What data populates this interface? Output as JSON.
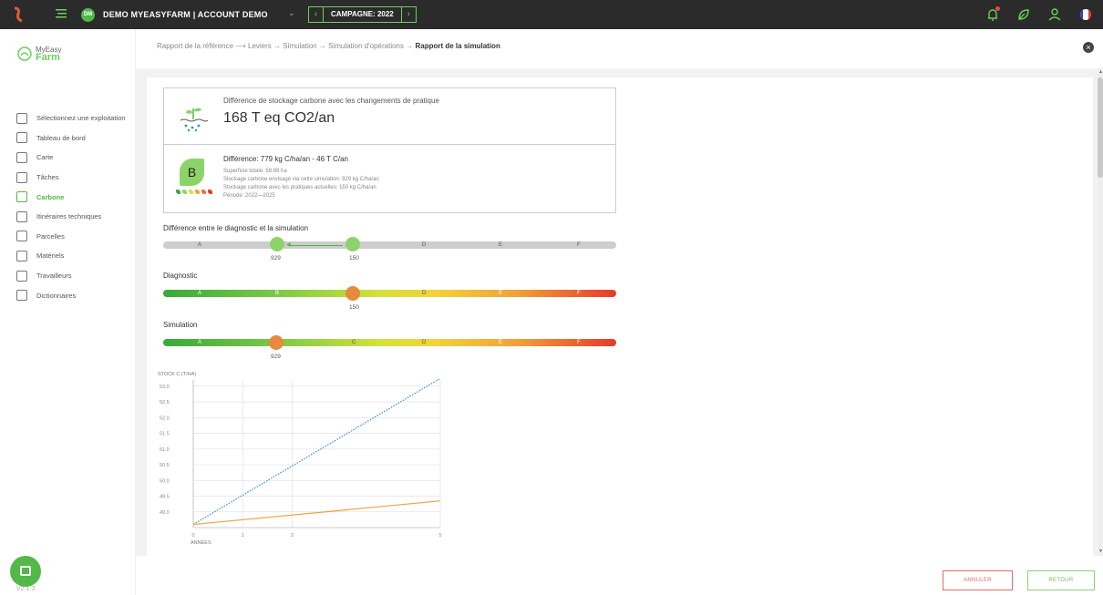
{
  "topbar": {
    "account": "DEMO MYEASYFARM | ACCOUNT DEMO",
    "avatar_initials": "DM",
    "campaign": "CAMPAGNE: 2022",
    "prev_arrow": "‹",
    "next_arrow": "›"
  },
  "brand": {
    "line1": "MyEasy",
    "line2": "Farm"
  },
  "sidebar": {
    "items": [
      {
        "label": "Sélectionnez une exploitation",
        "icon": "farm-select-icon"
      },
      {
        "label": "Tableau de bord",
        "icon": "dashboard-icon"
      },
      {
        "label": "Carte",
        "icon": "map-icon"
      },
      {
        "label": "Tâches",
        "icon": "tasks-icon"
      },
      {
        "label": "Carbone",
        "icon": "carbon-icon",
        "active": true
      },
      {
        "label": "Itinéraires techniques",
        "icon": "itinerary-icon"
      },
      {
        "label": "Parcelles",
        "icon": "parcels-icon"
      },
      {
        "label": "Matériels",
        "icon": "equipment-icon"
      },
      {
        "label": "Travailleurs",
        "icon": "workers-icon"
      },
      {
        "label": "Dictionnaires",
        "icon": "dictionary-icon"
      }
    ],
    "version": "V2.1.3"
  },
  "breadcrumb": {
    "items": [
      "Rapport de la référence",
      "Leviers",
      "Simulation",
      "Simulation d'opérations"
    ],
    "separators": [
      "⟶",
      "→",
      "→",
      "→"
    ],
    "current": "Rapport de la simulation"
  },
  "card1": {
    "title": "Différence de stockage carbone avec les changements de pratique",
    "value": "168 T eq CO2/an"
  },
  "card2": {
    "grade": "B",
    "title": "Différence: 779 kg C/ha/an - 46 T C/an",
    "lines": [
      "Superficie totale: 58.89 ha",
      "Stockage carbone envisagé via cette simulation: 929 kg C/ha/an",
      "Stockage carbone avec les pratiques actuelles: 150 kg C/ha/an",
      "Période: 2022—2025"
    ]
  },
  "grades": [
    "A",
    "B",
    "C",
    "D",
    "E",
    "F"
  ],
  "comparison": {
    "label": "Différence entre le diagnostic et la simulation",
    "from": "929",
    "to": "150"
  },
  "diagnostic": {
    "label": "Diagnostic",
    "value": "150"
  },
  "simulation": {
    "label": "Simulation",
    "value": "929"
  },
  "colors": {
    "accent": "#52b848",
    "marker_orange": "#e88a3e",
    "cancel": "#e26a6a"
  },
  "chart_data": {
    "type": "line",
    "ylabel": "STOCK C (T/HA)",
    "xlabel": "ANNÉES",
    "ylim": [
      48.5,
      53.2
    ],
    "yticks": [
      53.0,
      52.5,
      52.0,
      51.5,
      51.0,
      50.5,
      50.0,
      49.5,
      49.0
    ],
    "xticks": [
      0,
      1,
      2,
      5
    ],
    "xlim": [
      0,
      5
    ],
    "series": [
      {
        "style": "dotted",
        "color": "#3a8bd6",
        "x": [
          0,
          5
        ],
        "y": [
          48.6,
          53.25
        ]
      },
      {
        "style": "solid",
        "color": "#f0a040",
        "x": [
          0,
          5
        ],
        "y": [
          48.6,
          49.35
        ]
      }
    ]
  },
  "footer": {
    "cancel": "ANNULER",
    "back": "RETOUR"
  }
}
